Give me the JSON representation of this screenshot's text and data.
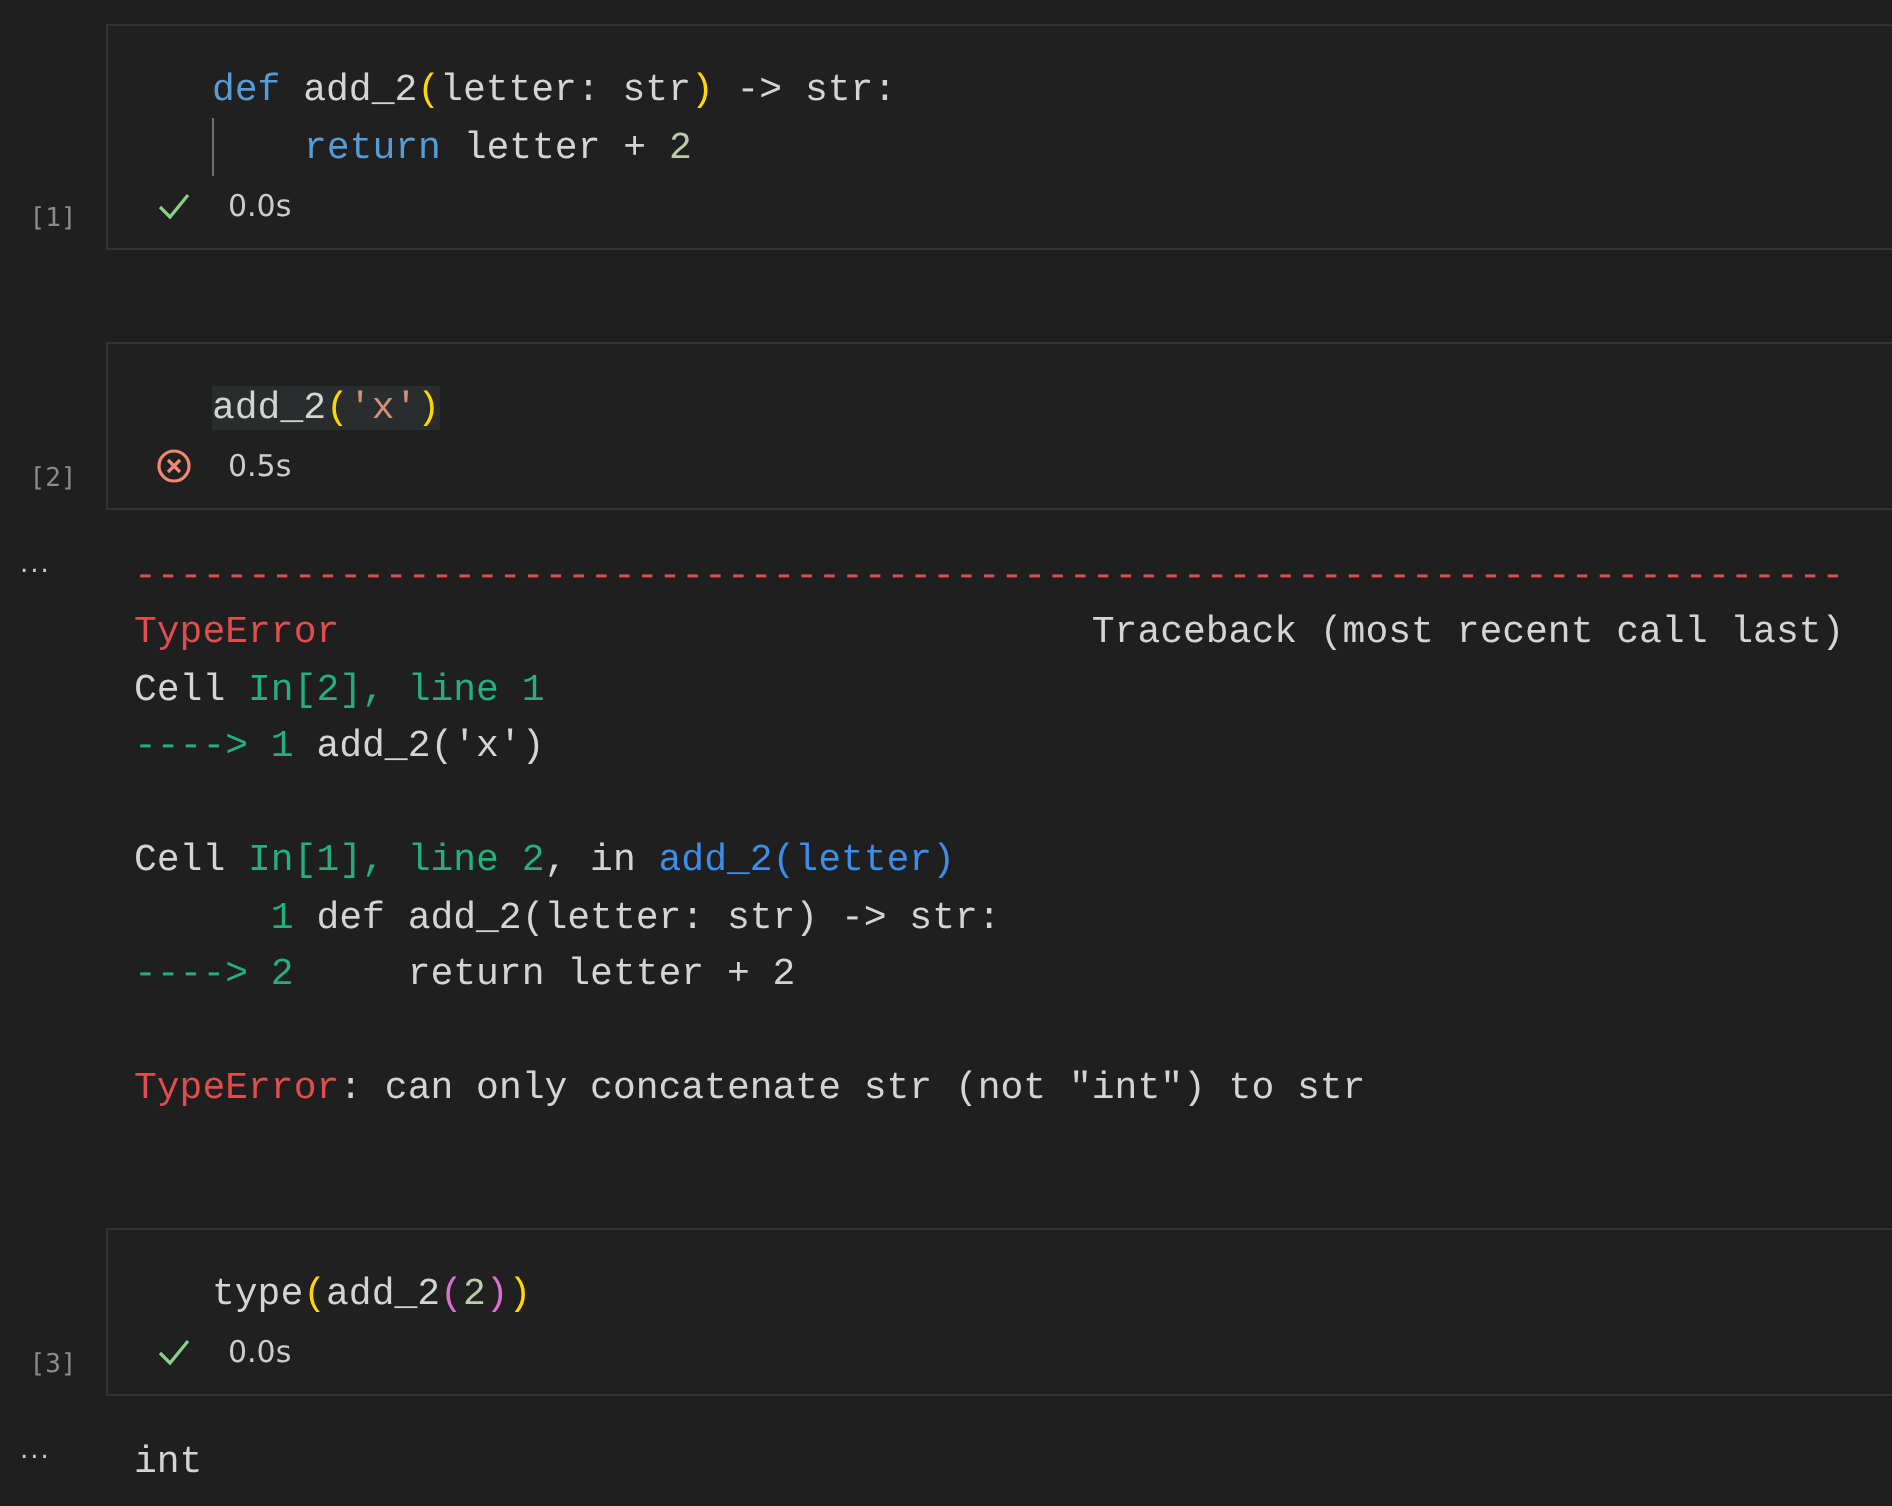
{
  "cells": [
    {
      "prompt": "[1]",
      "error": false,
      "time": "0.0s",
      "lines": [
        {
          "indent": false,
          "highlighted": false,
          "tokens": [
            {
              "t": "def",
              "kind": "keyword"
            },
            {
              "t": " add_2",
              "kind": "plain"
            },
            {
              "t": "(",
              "kind": "paren"
            },
            {
              "t": "letter: str",
              "kind": "plain"
            },
            {
              "t": ")",
              "kind": "paren"
            },
            {
              "t": " -> str:",
              "kind": "plain"
            }
          ]
        },
        {
          "indent": true,
          "highlighted": false,
          "tokens": [
            {
              "t": "return",
              "kind": "keyword"
            },
            {
              "t": " letter + ",
              "kind": "plain"
            },
            {
              "t": "2",
              "kind": "number"
            }
          ]
        }
      ]
    },
    {
      "prompt": "[2]",
      "error": true,
      "time": "0.5s",
      "lines": [
        {
          "indent": false,
          "highlighted": true,
          "tokens": [
            {
              "t": "add_2",
              "kind": "plain"
            },
            {
              "t": "(",
              "kind": "paren"
            },
            {
              "t": "'x'",
              "kind": "string"
            },
            {
              "t": ")",
              "kind": "paren"
            }
          ]
        }
      ],
      "output": {
        "marker": "...",
        "lines": [
          {
            "spaced": false,
            "tokens": [
              {
                "t": "---------------------------------------------------------------------------",
                "kind": "red"
              }
            ]
          },
          {
            "spaced": false,
            "tokens": [
              {
                "t": "TypeError",
                "kind": "red"
              },
              {
                "t": "                                 Traceback (most recent call last)",
                "kind": "plain"
              }
            ]
          },
          {
            "spaced": false,
            "tokens": [
              {
                "t": "Cell ",
                "kind": "plain"
              },
              {
                "t": "In[2], line 1",
                "kind": "green"
              }
            ]
          },
          {
            "spaced": false,
            "tokens": [
              {
                "t": "----> 1 ",
                "kind": "green"
              },
              {
                "t": "add_2('x')",
                "kind": "plain"
              }
            ]
          },
          {
            "spaced": true,
            "tokens": [
              {
                "t": "Cell ",
                "kind": "plain"
              },
              {
                "t": "In[1], line 2",
                "kind": "green"
              },
              {
                "t": ", in ",
                "kind": "plain"
              },
              {
                "t": "add_2(letter)",
                "kind": "blue"
              }
            ]
          },
          {
            "spaced": false,
            "tokens": [
              {
                "t": "      1 ",
                "kind": "green"
              },
              {
                "t": "def add_2(letter: str) -> str:",
                "kind": "plain"
              }
            ]
          },
          {
            "spaced": false,
            "tokens": [
              {
                "t": "----> 2 ",
                "kind": "green"
              },
              {
                "t": "    return letter + 2",
                "kind": "plain"
              }
            ]
          },
          {
            "spaced": true,
            "tokens": [
              {
                "t": "TypeError",
                "kind": "red"
              },
              {
                "t": ": can only concatenate str (not \"int\") to str",
                "kind": "plain"
              }
            ]
          }
        ]
      }
    },
    {
      "prompt": "[3]",
      "error": false,
      "time": "0.0s",
      "lines": [
        {
          "indent": false,
          "highlighted": false,
          "tokens": [
            {
              "t": "type",
              "kind": "plain"
            },
            {
              "t": "(",
              "kind": "paren"
            },
            {
              "t": "add_2",
              "kind": "plain"
            },
            {
              "t": "(",
              "kind": "paren2"
            },
            {
              "t": "2",
              "kind": "number"
            },
            {
              "t": ")",
              "kind": "paren2"
            },
            {
              "t": ")",
              "kind": "paren"
            }
          ]
        }
      ],
      "output": {
        "marker": "...",
        "lines": [
          {
            "spaced": false,
            "tokens": [
              {
                "t": "int",
                "kind": "plain"
              }
            ]
          }
        ]
      }
    }
  ]
}
